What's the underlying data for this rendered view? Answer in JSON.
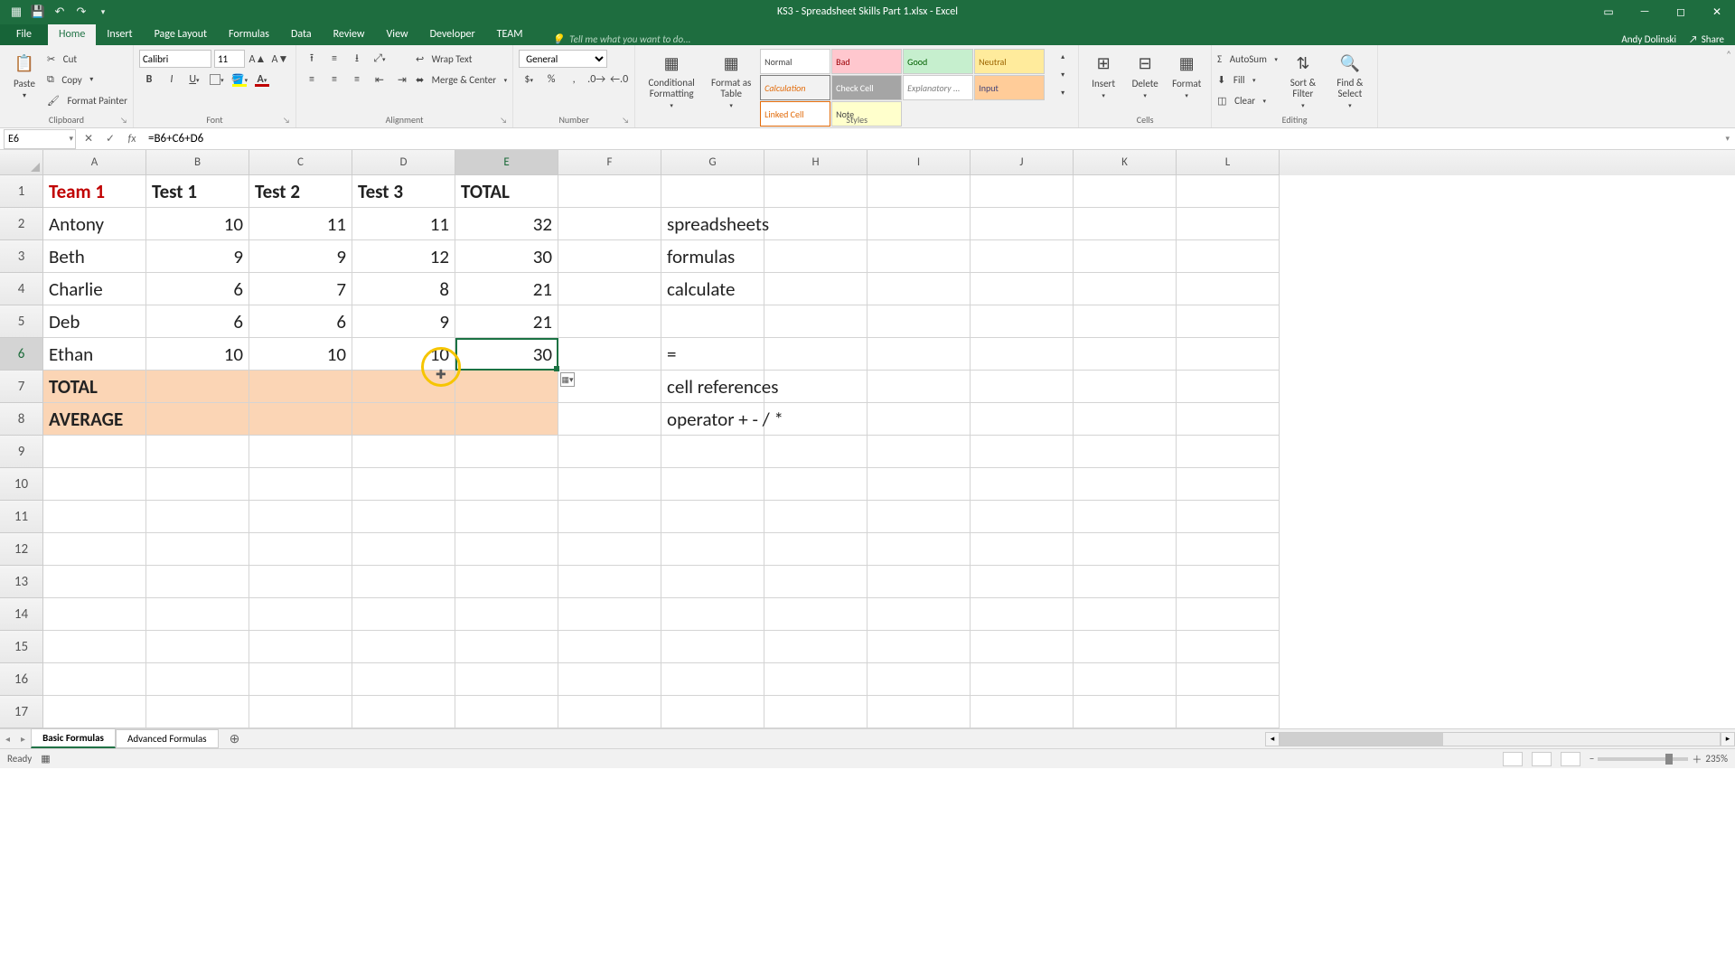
{
  "titlebar": {
    "title": "KS3 - Spreadsheet Skills Part 1.xlsx - Excel"
  },
  "account": {
    "user": "Andy Dolinski",
    "share": "Share"
  },
  "tabs": {
    "file": "File",
    "home": "Home",
    "insert": "Insert",
    "pagelayout": "Page Layout",
    "formulas": "Formulas",
    "data": "Data",
    "review": "Review",
    "view": "View",
    "developer": "Developer",
    "team": "TEAM",
    "tellme": "Tell me what you want to do..."
  },
  "ribbon": {
    "clipboard": {
      "paste": "Paste",
      "cut": "Cut",
      "copy": "Copy",
      "formatpainter": "Format Painter",
      "label": "Clipboard"
    },
    "font": {
      "name": "Calibri",
      "size": "11",
      "label": "Font"
    },
    "alignment": {
      "wrap": "Wrap Text",
      "merge": "Merge & Center",
      "label": "Alignment"
    },
    "number": {
      "format": "General",
      "label": "Number"
    },
    "styles": {
      "condfmt": "Conditional Formatting",
      "fmttable": "Format as Table",
      "normal": "Normal",
      "bad": "Bad",
      "good": "Good",
      "neutral": "Neutral",
      "calc": "Calculation",
      "check": "Check Cell",
      "expl": "Explanatory ...",
      "input": "Input",
      "linked": "Linked Cell",
      "note": "Note",
      "label": "Styles"
    },
    "cells": {
      "insert": "Insert",
      "delete": "Delete",
      "format": "Format",
      "label": "Cells"
    },
    "editing": {
      "autosum": "AutoSum",
      "fill": "Fill",
      "clear": "Clear",
      "sort": "Sort & Filter",
      "find": "Find & Select",
      "label": "Editing"
    }
  },
  "fxbar": {
    "ref": "E6",
    "formula": "=B6+C6+D6"
  },
  "cols": [
    "A",
    "B",
    "C",
    "D",
    "E",
    "F",
    "G",
    "H",
    "I",
    "J",
    "K",
    "L"
  ],
  "grid": {
    "A1": "Team 1",
    "B1": "Test 1",
    "C1": "Test 2",
    "D1": "Test 3",
    "E1": "TOTAL",
    "A2": "Antony",
    "B2": "10",
    "C2": "11",
    "D2": "11",
    "E2": "32",
    "G2": "spreadsheets",
    "A3": "Beth",
    "B3": "9",
    "C3": "9",
    "D3": "12",
    "E3": "30",
    "G3": "formulas",
    "A4": "Charlie",
    "B4": "6",
    "C4": "7",
    "D4": "8",
    "E4": "21",
    "G4": "calculate",
    "A5": "Deb",
    "B5": "6",
    "C5": "6",
    "D5": "9",
    "E5": "21",
    "A6": "Ethan",
    "B6": "10",
    "C6": "10",
    "D6": "10",
    "E6": "30",
    "G6": "=",
    "A7": "TOTAL",
    "G7": "cell references",
    "A8": "AVERAGE",
    "G8": "operator +  -  /  *"
  },
  "sheets": {
    "s1": "Basic Formulas",
    "s2": "Advanced Formulas"
  },
  "status": {
    "ready": "Ready",
    "zoom": "235%"
  }
}
